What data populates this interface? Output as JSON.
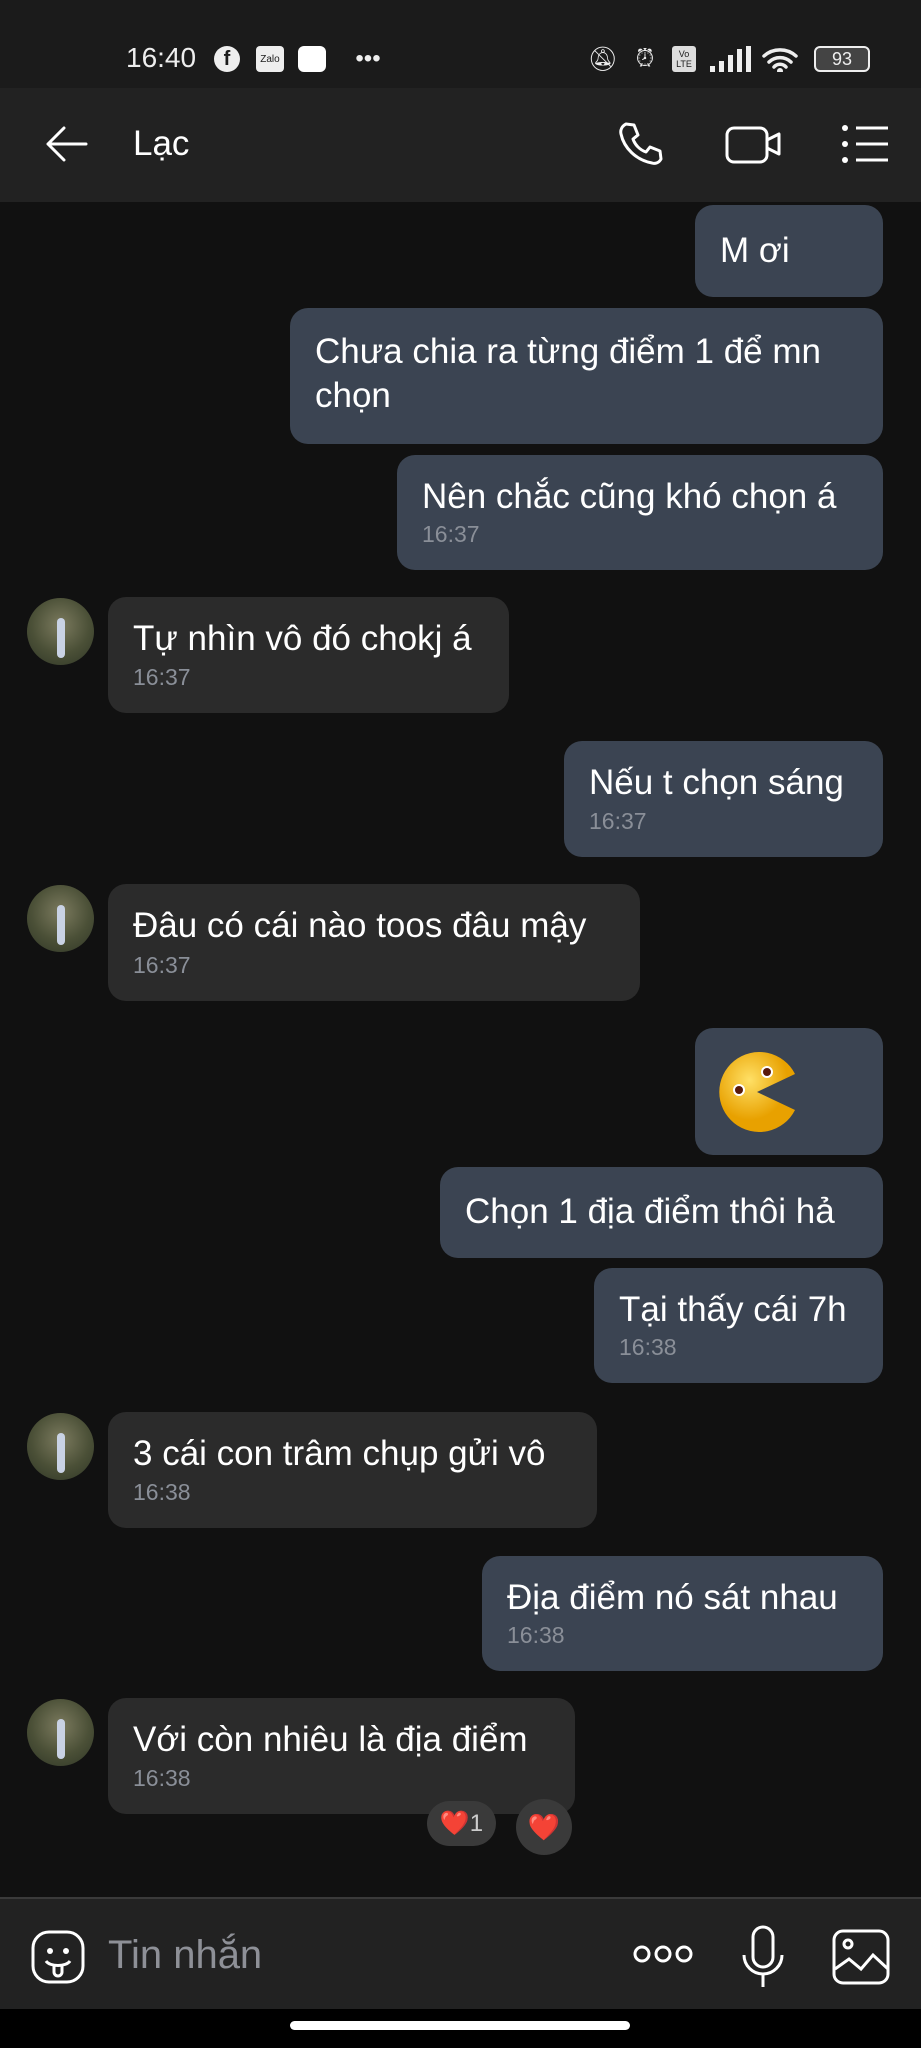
{
  "status_bar": {
    "time": "16:40",
    "zalo_label": "Zalo",
    "volte_label": "Vo LTE",
    "battery": "93",
    "icons": [
      "facebook-icon",
      "zalo-icon",
      "app-icon",
      "more-dots-icon",
      "mute-icon",
      "alarm-icon",
      "volte-icon",
      "signal-icon",
      "wifi-icon",
      "battery-icon"
    ]
  },
  "header": {
    "title": "Lạc",
    "icons": [
      "back-arrow-icon",
      "phone-icon",
      "video-call-icon",
      "menu-list-icon"
    ]
  },
  "colors": {
    "sent_bubble": "#3b4452",
    "received_bubble": "#2b2b2b",
    "background": "#111111"
  },
  "messages": [
    {
      "side": "sent",
      "text": "M ơi"
    },
    {
      "side": "sent",
      "text": "Chưa chia ra từng điểm 1 để mn chọn"
    },
    {
      "side": "sent",
      "text": "Nên chắc cũng khó chọn á",
      "time": "16:37"
    },
    {
      "side": "received",
      "text": "Tự nhìn vô đó chokj á",
      "time": "16:37"
    },
    {
      "side": "sent",
      "text": "Nếu t chọn sáng",
      "time": "16:37"
    },
    {
      "side": "received",
      "text": "Đâu có cái nào toos đâu mậy",
      "time": "16:37"
    },
    {
      "side": "sent",
      "sticker": "pacman-emoji"
    },
    {
      "side": "sent",
      "text": "Chọn 1 địa điểm thôi hả"
    },
    {
      "side": "sent",
      "text": "Tại thấy cái 7h",
      "time": "16:38"
    },
    {
      "side": "received",
      "text": "3 cái con trâm chụp gửi vô",
      "time": "16:38"
    },
    {
      "side": "sent",
      "text": "Địa điểm nó sát nhau",
      "time": "16:38"
    },
    {
      "side": "received",
      "text": "Với còn nhiêu là địa điểm",
      "time": "16:38",
      "reaction": {
        "emoji": "❤️",
        "count": "1"
      },
      "react_button": "❤️"
    }
  ],
  "input": {
    "placeholder": "Tin nhắn",
    "icons": [
      "sticker-icon",
      "more-icon",
      "microphone-icon",
      "image-icon"
    ]
  }
}
